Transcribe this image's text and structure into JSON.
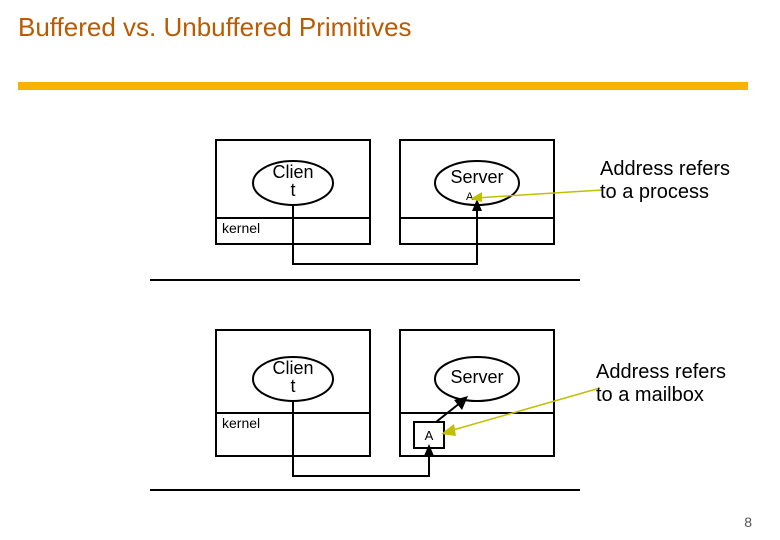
{
  "title": "Buffered vs. Unbuffered Primitives",
  "page_number": "8",
  "diagram1": {
    "client_label": "Clien\nt",
    "server_label": "Server",
    "kernel_label": "kernel",
    "process_id": "A",
    "caption": "Address refers to a process"
  },
  "diagram2": {
    "client_label": "Clien\nt",
    "server_label": "Server",
    "kernel_label": "kernel",
    "mailbox_id": "A",
    "caption": "Address refers to a mailbox"
  }
}
